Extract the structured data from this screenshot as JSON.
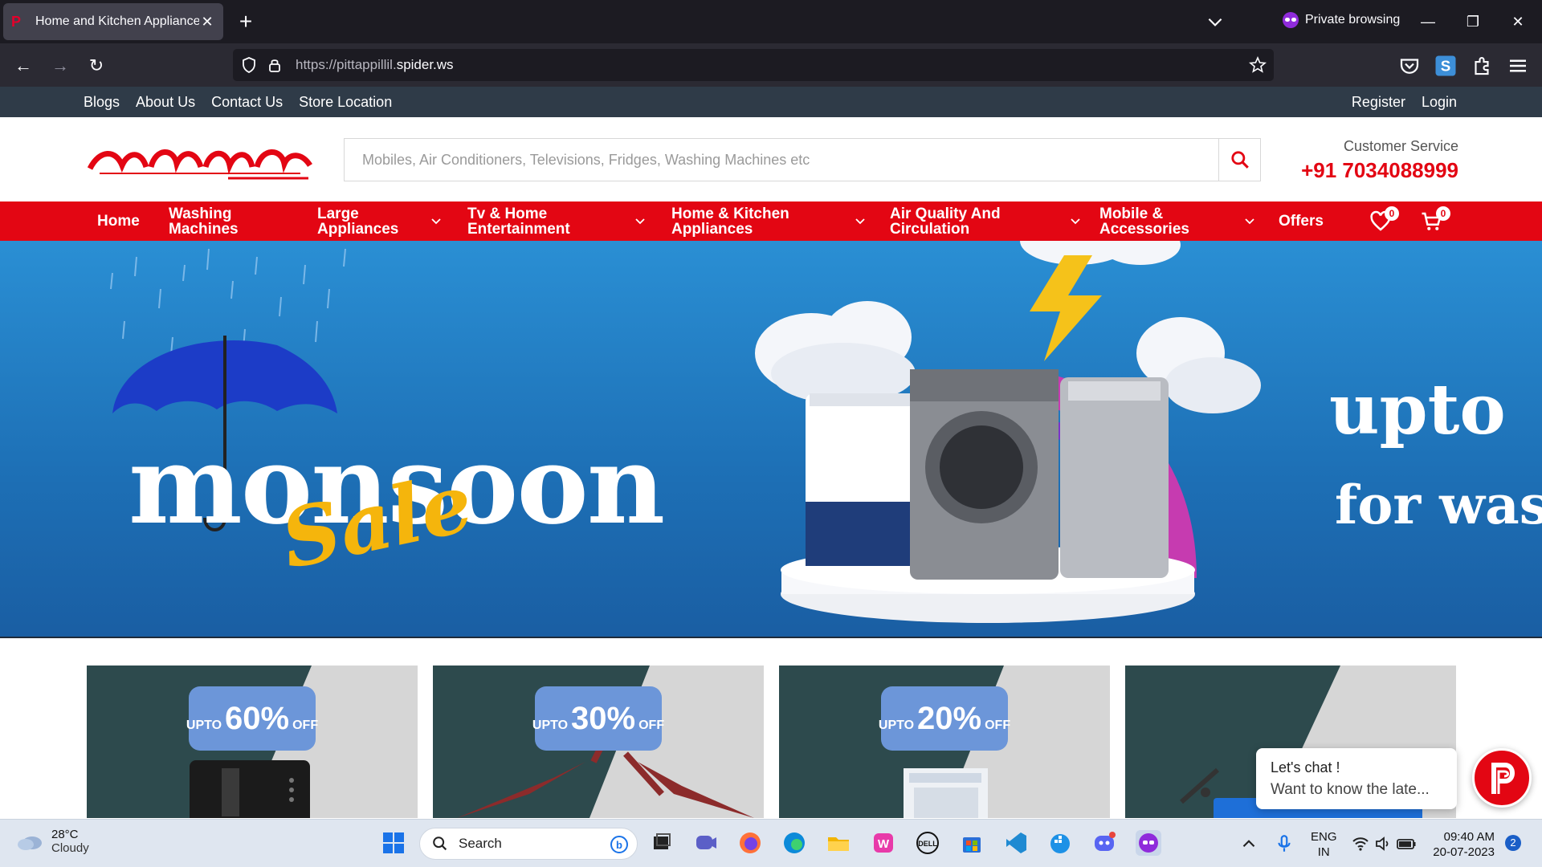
{
  "browser": {
    "tab_title": "Home and Kitchen Appliances",
    "private_label": "Private browsing",
    "url_prefix": "https://pittappillil.",
    "url_domain": "spider.ws"
  },
  "site": {
    "top_links": [
      "Blogs",
      "About Us",
      "Contact Us",
      "Store Location"
    ],
    "account_links": [
      "Register",
      "Login"
    ],
    "search_placeholder": "Mobiles, Air Conditioners, Televisions, Fridges, Washing Machines etc",
    "customer_service_label": "Customer Service",
    "phone": "+91 7034088999",
    "menu": {
      "home": "Home",
      "washing_1": "Washing",
      "washing_2": "Machines",
      "large_1": "Large",
      "large_2": "Appliances",
      "tv_1": "Tv & Home",
      "tv_2": "Entertainment",
      "hk_1": "Home & Kitchen",
      "hk_2": "Appliances",
      "aq_1": "Air Quality And",
      "aq_2": "Circulation",
      "mob_1": "Mobile &",
      "mob_2": "Accessories",
      "offers": "Offers"
    },
    "wishlist_count": "0",
    "cart_count": "0",
    "hero": {
      "title": "monsoon",
      "script": "Sale",
      "right_line1": "upto",
      "right_line2": "for was"
    },
    "cards": [
      {
        "pre": "UPTO",
        "value": "60%",
        "post": "OFF"
      },
      {
        "pre": "UPTO",
        "value": "30%",
        "post": "OFF"
      },
      {
        "pre": "UPTO",
        "value": "20%",
        "post": "OFF"
      }
    ],
    "chat": {
      "line1": "Let's chat !",
      "line2": "Want to know the late..."
    }
  },
  "taskbar": {
    "temp": "28°C",
    "condition": "Cloudy",
    "search_label": "Search",
    "lang1": "ENG",
    "lang2": "IN",
    "time": "09:40 AM",
    "date": "20-07-2023",
    "notifications": "2"
  }
}
